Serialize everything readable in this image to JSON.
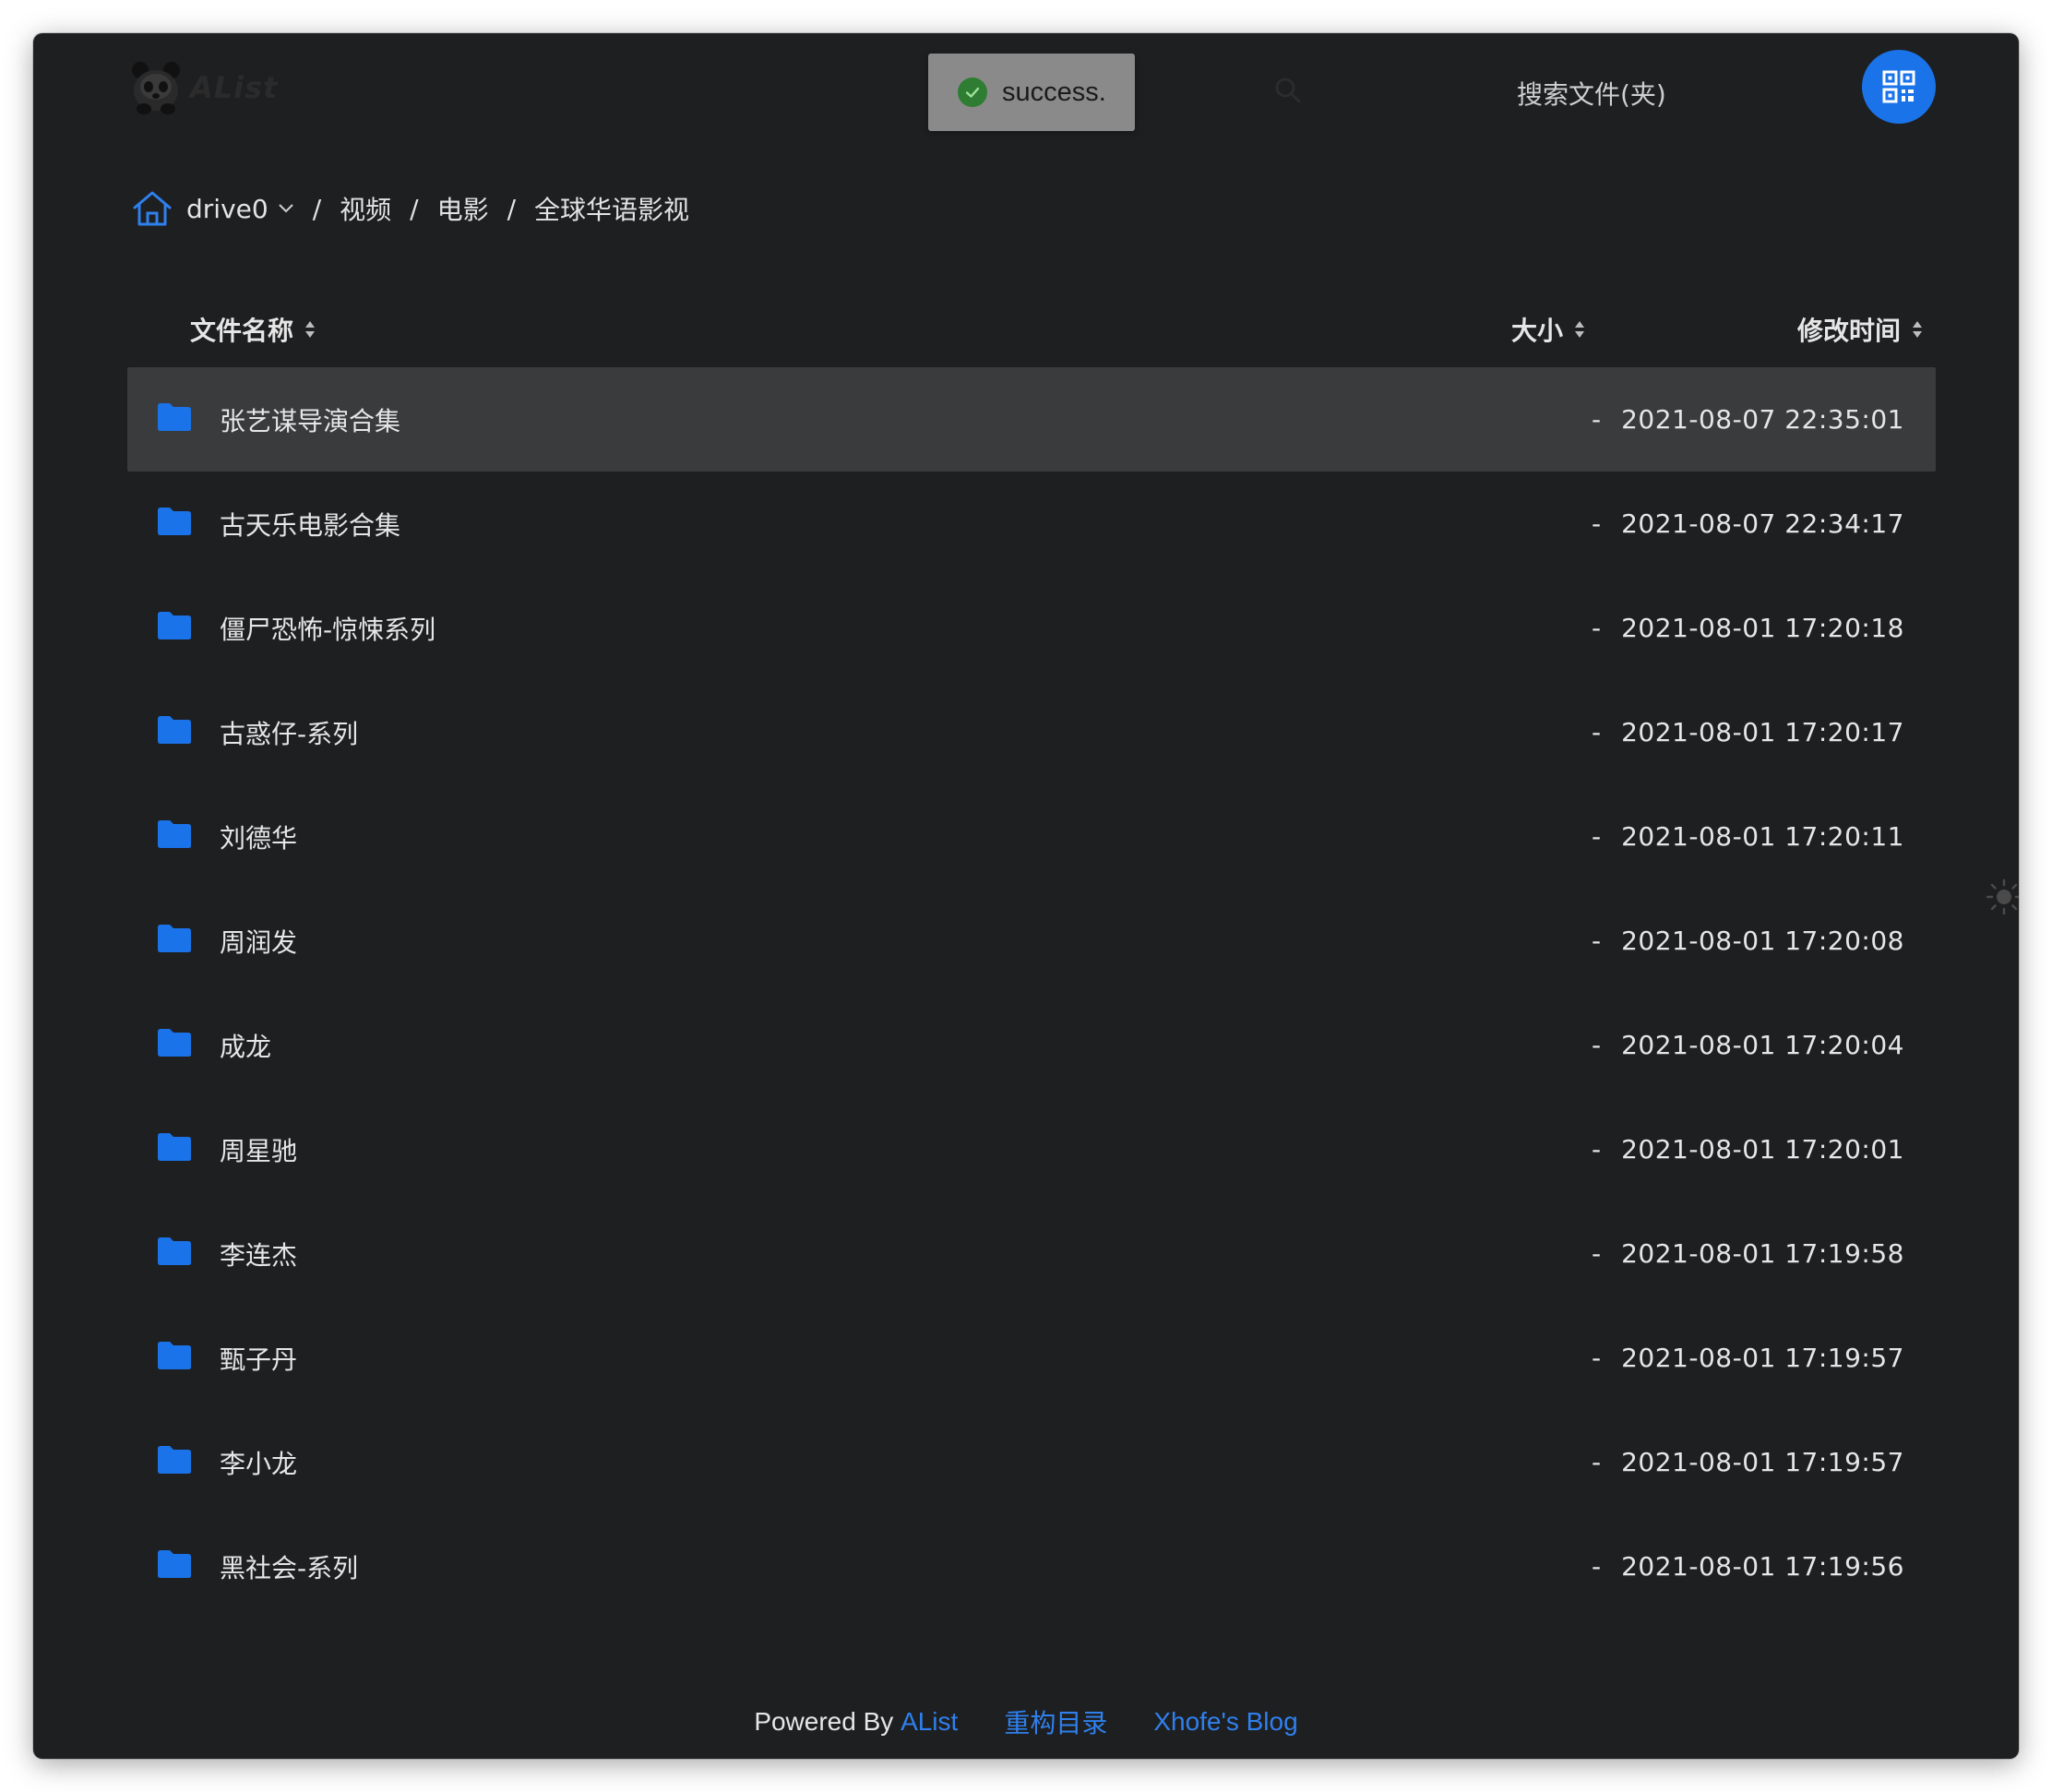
{
  "app": {
    "logo_text": "AList"
  },
  "toast": {
    "message": "success."
  },
  "search": {
    "placeholder": "搜索文件(夹)"
  },
  "breadcrumb": {
    "drive": "drive0",
    "items": [
      "视频",
      "电影",
      "全球华语影视"
    ]
  },
  "table": {
    "columns": {
      "name": "文件名称",
      "size": "大小",
      "modified": "修改时间"
    },
    "rows": [
      {
        "name": "张艺谋导演合集",
        "size": "-",
        "modified": "2021-08-07 22:35:01"
      },
      {
        "name": "古天乐电影合集",
        "size": "-",
        "modified": "2021-08-07 22:34:17"
      },
      {
        "name": "僵尸恐怖-惊悚系列",
        "size": "-",
        "modified": "2021-08-01 17:20:18"
      },
      {
        "name": "古惑仔-系列",
        "size": "-",
        "modified": "2021-08-01 17:20:17"
      },
      {
        "name": "刘德华",
        "size": "-",
        "modified": "2021-08-01 17:20:11"
      },
      {
        "name": "周润发",
        "size": "-",
        "modified": "2021-08-01 17:20:08"
      },
      {
        "name": "成龙",
        "size": "-",
        "modified": "2021-08-01 17:20:04"
      },
      {
        "name": "周星驰",
        "size": "-",
        "modified": "2021-08-01 17:20:01"
      },
      {
        "name": "李连杰",
        "size": "-",
        "modified": "2021-08-01 17:19:58"
      },
      {
        "name": "甄子丹",
        "size": "-",
        "modified": "2021-08-01 17:19:57"
      },
      {
        "name": "李小龙",
        "size": "-",
        "modified": "2021-08-01 17:19:57"
      },
      {
        "name": "黑社会-系列",
        "size": "-",
        "modified": "2021-08-01 17:19:56"
      }
    ]
  },
  "footer": {
    "powered_by": "Powered By",
    "alist_link": "AList",
    "rebuild_link": "重构目录",
    "blog_link": "Xhofe's Blog"
  },
  "colors": {
    "background": "#1e1f21",
    "accent": "#1a73e8",
    "folder": "#1a73e8",
    "row_hover": "#3a3b3d",
    "toast_bg": "#8a8a8a",
    "success": "#2e7d32"
  },
  "icons": {
    "home": "home-icon",
    "folder": "folder-icon",
    "search": "search-icon",
    "qr": "qr-code-icon",
    "sort": "sort-icon",
    "theme": "sun-icon",
    "chevron": "chevron-down-icon",
    "check": "check-circle-icon"
  },
  "state": {
    "highlighted_row": 0
  }
}
